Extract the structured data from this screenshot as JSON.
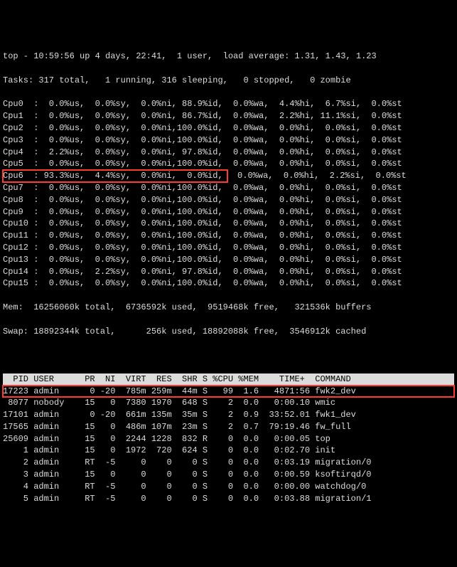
{
  "header": {
    "summary": "top - 10:59:56 up 4 days, 22:41,  1 user,  load average: 1.31, 1.43, 1.23",
    "tasks": "Tasks: 317 total,   1 running, 316 sleeping,   0 stopped,   0 zombie"
  },
  "cpus": [
    {
      "name": "Cpu0",
      "text": "Cpu0  :  0.0%us,  0.0%sy,  0.0%ni, 88.9%id,  0.0%wa,  4.4%hi,  6.7%si,  0.0%st"
    },
    {
      "name": "Cpu1",
      "text": "Cpu1  :  0.0%us,  0.0%sy,  0.0%ni, 86.7%id,  0.0%wa,  2.2%hi, 11.1%si,  0.0%st"
    },
    {
      "name": "Cpu2",
      "text": "Cpu2  :  0.0%us,  0.0%sy,  0.0%ni,100.0%id,  0.0%wa,  0.0%hi,  0.0%si,  0.0%st"
    },
    {
      "name": "Cpu3",
      "text": "Cpu3  :  0.0%us,  0.0%sy,  0.0%ni,100.0%id,  0.0%wa,  0.0%hi,  0.0%si,  0.0%st"
    },
    {
      "name": "Cpu4",
      "text": "Cpu4  :  2.2%us,  0.0%sy,  0.0%ni, 97.8%id,  0.0%wa,  0.0%hi,  0.0%si,  0.0%st"
    },
    {
      "name": "Cpu5",
      "text": "Cpu5  :  0.0%us,  0.0%sy,  0.0%ni,100.0%id,  0.0%wa,  0.0%hi,  0.0%si,  0.0%st"
    },
    {
      "name": "Cpu6",
      "text": "Cpu6  : 93.3%us,  4.4%sy,  0.0%ni,  0.0%id,",
      "tail": "  0.0%wa,  0.0%hi,  2.2%si,  0.0%st",
      "highlight": true
    },
    {
      "name": "Cpu7",
      "text": "Cpu7  :  0.0%us,  0.0%sy,  0.0%ni,100.0%id,  0.0%wa,  0.0%hi,  0.0%si,  0.0%st"
    },
    {
      "name": "Cpu8",
      "text": "Cpu8  :  0.0%us,  0.0%sy,  0.0%ni,100.0%id,  0.0%wa,  0.0%hi,  0.0%si,  0.0%st"
    },
    {
      "name": "Cpu9",
      "text": "Cpu9  :  0.0%us,  0.0%sy,  0.0%ni,100.0%id,  0.0%wa,  0.0%hi,  0.0%si,  0.0%st"
    },
    {
      "name": "Cpu10",
      "text": "Cpu10 :  0.0%us,  0.0%sy,  0.0%ni,100.0%id,  0.0%wa,  0.0%hi,  0.0%si,  0.0%st"
    },
    {
      "name": "Cpu11",
      "text": "Cpu11 :  0.0%us,  0.0%sy,  0.0%ni,100.0%id,  0.0%wa,  0.0%hi,  0.0%si,  0.0%st"
    },
    {
      "name": "Cpu12",
      "text": "Cpu12 :  0.0%us,  0.0%sy,  0.0%ni,100.0%id,  0.0%wa,  0.0%hi,  0.0%si,  0.0%st"
    },
    {
      "name": "Cpu13",
      "text": "Cpu13 :  0.0%us,  0.0%sy,  0.0%ni,100.0%id,  0.0%wa,  0.0%hi,  0.0%si,  0.0%st"
    },
    {
      "name": "Cpu14",
      "text": "Cpu14 :  0.0%us,  2.2%sy,  0.0%ni, 97.8%id,  0.0%wa,  0.0%hi,  0.0%si,  0.0%st"
    },
    {
      "name": "Cpu15",
      "text": "Cpu15 :  0.0%us,  0.0%sy,  0.0%ni,100.0%id,  0.0%wa,  0.0%hi,  0.0%si,  0.0%st"
    }
  ],
  "mem": "Mem:  16256060k total,  6736592k used,  9519468k free,   321536k buffers",
  "swap": "Swap: 18892344k total,      256k used, 18892088k free,  3546912k cached",
  "table_header": "  PID USER      PR  NI  VIRT  RES  SHR S %CPU %MEM    TIME+  COMMAND           ",
  "processes": [
    {
      "line": "17223 admin      0 -20  785m 259m  44m S   99  1.6   4871:56 fwk2_dev",
      "highlight": true
    },
    {
      "line": " 8077 nobody    15   0  7380 1970  648 S    2  0.0   0:00.10 wmic"
    },
    {
      "line": "17101 admin      0 -20  661m 135m  35m S    2  0.9  33:52.01 fwk1_dev"
    },
    {
      "line": "17565 admin     15   0  486m 107m  23m S    2  0.7  79:19.46 fw_full"
    },
    {
      "line": "25609 admin     15   0  2244 1228  832 R    0  0.0   0:00.05 top"
    },
    {
      "line": "    1 admin     15   0  1972  720  624 S    0  0.0   0:02.70 init"
    },
    {
      "line": "    2 admin     RT  -5     0    0    0 S    0  0.0   0:03.19 migration/0"
    },
    {
      "line": "    3 admin     15   0     0    0    0 S    0  0.0   0:00.59 ksoftirqd/0"
    },
    {
      "line": "    4 admin     RT  -5     0    0    0 S    0  0.0   0:00.00 watchdog/0"
    },
    {
      "line": "    5 admin     RT  -5     0    0    0 S    0  0.0   0:03.88 migration/1"
    }
  ]
}
